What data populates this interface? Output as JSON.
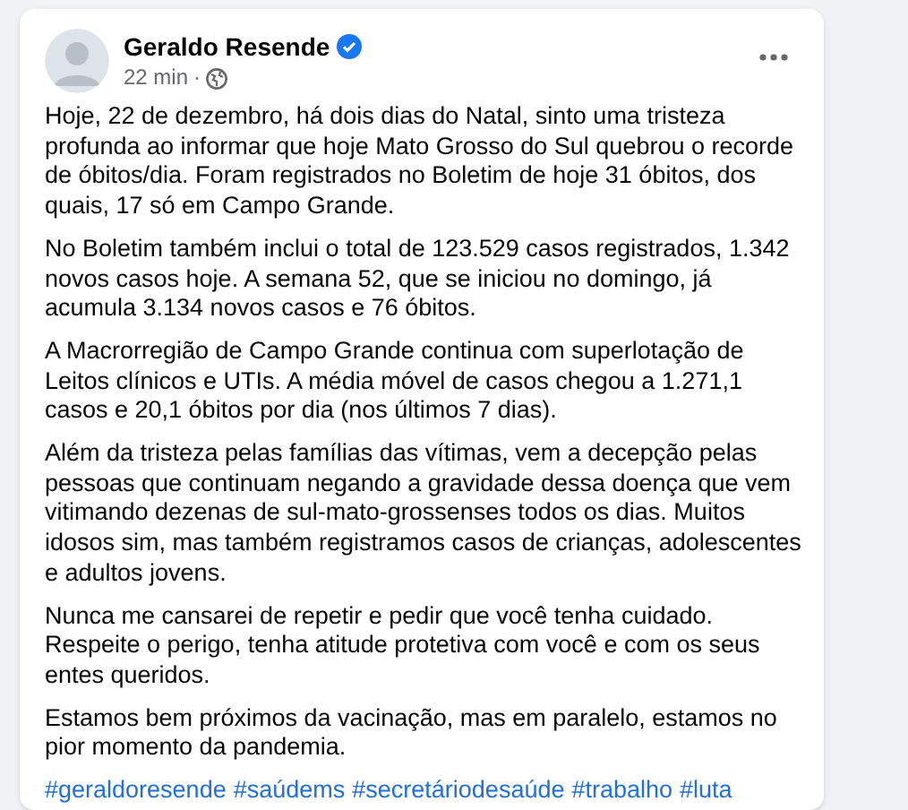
{
  "post": {
    "author": "Geraldo Resende",
    "verified": true,
    "time": "22 min",
    "separator": "·",
    "paragraphs": [
      "Hoje, 22 de dezembro, há dois dias do Natal, sinto uma tristeza profunda ao informar que hoje Mato Grosso do Sul quebrou o recorde de óbitos/dia. Foram registrados no Boletim de hoje 31 óbitos, dos quais, 17 só em Campo Grande.",
      "No Boletim também inclui o total de 123.529 casos registrados, 1.342 novos casos hoje. A semana 52, que se iniciou no domingo, já acumula 3.134 novos casos e 76 óbitos.",
      "A Macrorregião de Campo Grande continua com superlotação de Leitos clínicos e UTIs. A média móvel de casos chegou a 1.271,1 casos e 20,1 óbitos por dia (nos últimos 7 dias).",
      "Além da tristeza pelas famílias das vítimas, vem a decepção pelas pessoas que continuam negando a gravidade dessa doença que vem vitimando dezenas de sul-mato-grossenses todos os dias. Muitos idosos sim, mas também registramos casos de crianças, adolescentes e adultos jovens.",
      "Nunca me cansarei de repetir e pedir que você tenha cuidado. Respeite o perigo, tenha atitude protetiva com você e com os seus entes queridos.",
      "Estamos bem próximos da vacinação, mas em paralelo, estamos no pior momento da pandemia."
    ],
    "hashtags": [
      "#geraldoresende",
      "#saúdems",
      "#secretáriodesaúde",
      "#trabalho",
      "#luta"
    ]
  }
}
